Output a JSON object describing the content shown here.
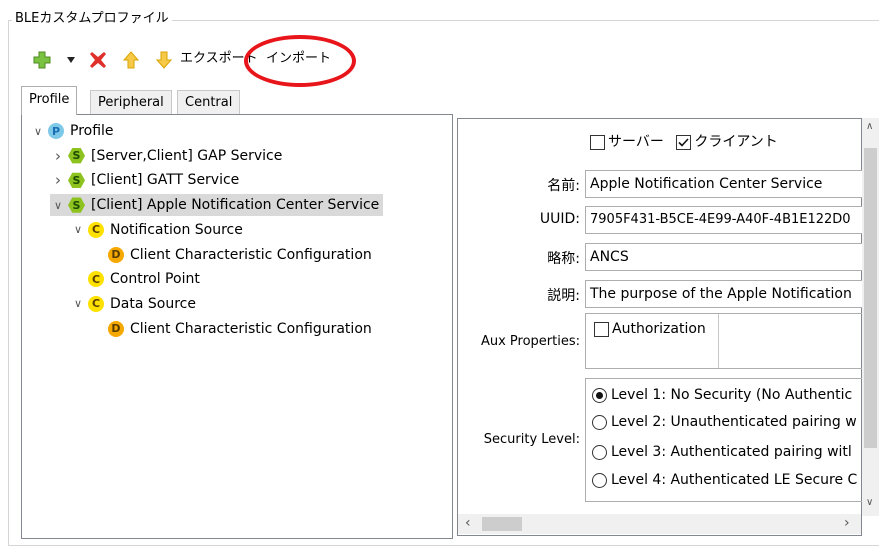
{
  "group": {
    "title": "BLEカスタムプロファイル"
  },
  "toolbar": {
    "export_label": "エクスポート",
    "import_label": "インポート"
  },
  "tabs": [
    {
      "label": "Profile",
      "active": true
    },
    {
      "label": "Peripheral",
      "active": false
    },
    {
      "label": "Central",
      "active": false
    }
  ],
  "tree": [
    {
      "badge": "P",
      "label": "Profile",
      "expander": "expanded"
    },
    {
      "badge": "S",
      "label": "[Server,Client] GAP Service",
      "expander": "collapsed"
    },
    {
      "badge": "S",
      "label": "[Client] GATT Service",
      "expander": "collapsed"
    },
    {
      "badge": "S",
      "label": "[Client] Apple Notification Center Service",
      "expander": "expanded",
      "selected": true
    },
    {
      "badge": "C",
      "label": "Notification Source",
      "expander": "expanded"
    },
    {
      "badge": "D",
      "label": "Client Characteristic Configuration",
      "expander": "none"
    },
    {
      "badge": "C",
      "label": "Control Point",
      "expander": "none"
    },
    {
      "badge": "C",
      "label": "Data Source",
      "expander": "expanded"
    },
    {
      "badge": "D",
      "label": "Client Characteristic Configuration",
      "expander": "none"
    }
  ],
  "form": {
    "server_label": "サーバー",
    "server_checked": false,
    "client_label": "クライアント",
    "client_checked": true,
    "name_label": "名前:",
    "name_value": "Apple Notification Center Service",
    "uuid_label": "UUID:",
    "uuid_value": "7905F431-B5CE-4E99-A40F-4B1E122D0",
    "abbr_label": "略称:",
    "abbr_value": "ANCS",
    "desc_label": "説明:",
    "desc_value": "The purpose of the Apple Notification",
    "aux_label": "Aux Properties:",
    "aux_auth_label": "Authorization",
    "security_label": "Security Level:",
    "security_options": [
      {
        "label": "Level 1: No Security (No Authentic",
        "selected": true
      },
      {
        "label": "Level 2: Unauthenticated pairing w",
        "selected": false
      },
      {
        "label": "Level 3: Authenticated pairing witl",
        "selected": false
      },
      {
        "label": "Level 4: Authenticated LE Secure C",
        "selected": false
      }
    ]
  },
  "colors": {
    "S_badge": "#8dc21f",
    "C_badge": "#ffe100",
    "D_badge": "#f5a800",
    "P_badge": "#7ec8e8",
    "highlight_circle": "#e8151b",
    "selected_row": "#d9d9d9"
  }
}
